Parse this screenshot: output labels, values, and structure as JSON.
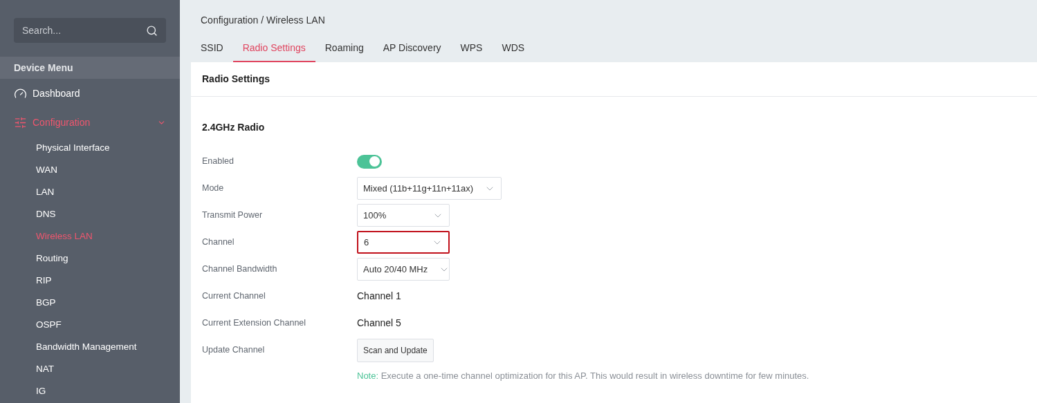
{
  "sidebar": {
    "search": {
      "placeholder": "Search..."
    },
    "section_title": "Device Menu",
    "items": [
      {
        "label": "Dashboard",
        "kind": "link",
        "selected": false
      },
      {
        "label": "Configuration",
        "kind": "group",
        "selected": true,
        "expanded": true,
        "children": [
          {
            "label": "Physical Interface",
            "selected": false
          },
          {
            "label": "WAN",
            "selected": false
          },
          {
            "label": "LAN",
            "selected": false
          },
          {
            "label": "DNS",
            "selected": false
          },
          {
            "label": "Wireless LAN",
            "selected": true
          },
          {
            "label": "Routing",
            "selected": false
          },
          {
            "label": "RIP",
            "selected": false
          },
          {
            "label": "BGP",
            "selected": false
          },
          {
            "label": "OSPF",
            "selected": false
          },
          {
            "label": "Bandwidth Management",
            "selected": false
          },
          {
            "label": "NAT",
            "selected": false
          },
          {
            "label": "IG",
            "selected": false
          }
        ]
      }
    ]
  },
  "breadcrumb": "Configuration / Wireless LAN",
  "tabs": [
    {
      "label": "SSID",
      "selected": false
    },
    {
      "label": "Radio Settings",
      "selected": true
    },
    {
      "label": "Roaming",
      "selected": false
    },
    {
      "label": "AP Discovery",
      "selected": false
    },
    {
      "label": "WPS",
      "selected": false
    },
    {
      "label": "WDS",
      "selected": false
    }
  ],
  "card": {
    "title": "Radio Settings",
    "section": "2.4GHz Radio",
    "rows": [
      {
        "label": "Enabled",
        "kind": "toggle",
        "on": true
      },
      {
        "label": "Mode",
        "kind": "select",
        "value": "Mixed (11b+11g+11n+11ax)",
        "highlighted": false
      },
      {
        "label": "Transmit Power",
        "kind": "select",
        "value": "100%",
        "highlighted": false
      },
      {
        "label": "Channel",
        "kind": "select",
        "value": "6",
        "highlighted": true
      },
      {
        "label": "Channel Bandwidth",
        "kind": "select",
        "value": "Auto 20/40 MHz",
        "highlighted": false
      },
      {
        "label": "Current Channel",
        "kind": "text",
        "value": "Channel 1"
      },
      {
        "label": "Current Extension Channel",
        "kind": "text",
        "value": "Channel 5"
      },
      {
        "label": "Update Channel",
        "kind": "button",
        "value": "Scan and Update"
      }
    ],
    "note": {
      "label": "Note:",
      "text": "Execute a one-time channel optimization for this AP. This would result in wireless downtime for few minutes."
    }
  }
}
